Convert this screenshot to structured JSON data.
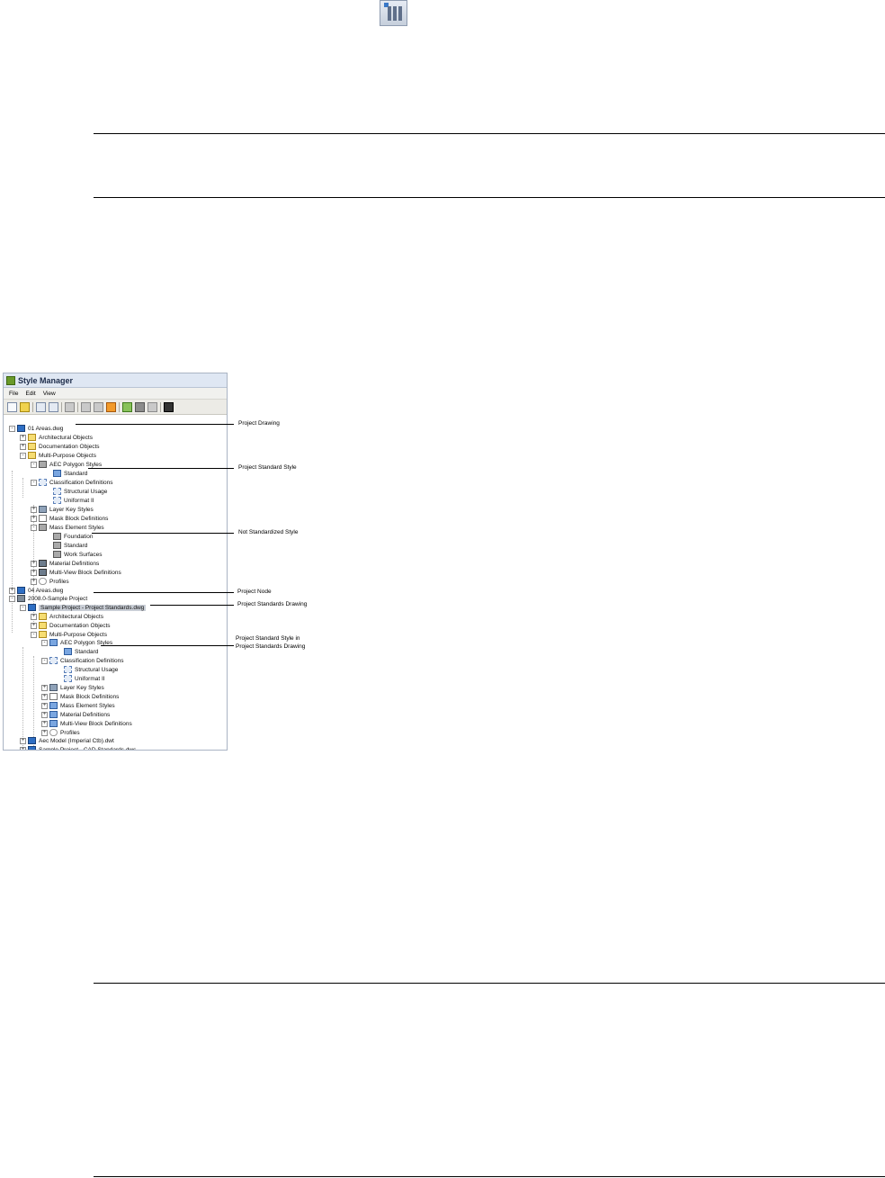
{
  "window": {
    "title": "Style Manager"
  },
  "menu": [
    {
      "label": "File"
    },
    {
      "label": "Edit"
    },
    {
      "label": "View"
    }
  ],
  "toolbar_icons": [
    "new-drawing-icon",
    "open-drawing-icon",
    "copy-icon",
    "paste-icon",
    "edit-style-icon",
    "purge-icon",
    "synchronize-icon",
    "warning-icon",
    "filter-icon",
    "toggle-view-icon",
    "dropdown-icon",
    "help-icon"
  ],
  "tree": {
    "n01": {
      "label": "01 Areas.dwg",
      "exp": "-",
      "icon": "drawing"
    },
    "n02": {
      "label": "Architectural Objects",
      "exp": "+",
      "icon": "folder"
    },
    "n03": {
      "label": "Documentation Objects",
      "exp": "+",
      "icon": "folder"
    },
    "n04": {
      "label": "Multi-Purpose Objects",
      "exp": "-",
      "icon": "folder"
    },
    "n05": {
      "label": "AEC Polygon Styles",
      "exp": "-",
      "icon": "style"
    },
    "n06": {
      "label": "Standard",
      "exp": "",
      "icon": "style-blue"
    },
    "n07": {
      "label": "Classification Definitions",
      "exp": "-",
      "icon": "classif"
    },
    "n08": {
      "label": "Structural Usage",
      "exp": "",
      "icon": "classif"
    },
    "n09": {
      "label": "Uniformat II",
      "exp": "",
      "icon": "classif"
    },
    "n10": {
      "label": "Layer Key Styles",
      "exp": "+",
      "icon": "layer"
    },
    "n11": {
      "label": "Mask Block Definitions",
      "exp": "+",
      "icon": "mask"
    },
    "n12": {
      "label": "Mass Element Styles",
      "exp": "-",
      "icon": "style"
    },
    "n13": {
      "label": "Foundation",
      "exp": "",
      "icon": "style"
    },
    "n14": {
      "label": "Standard",
      "exp": "",
      "icon": "style"
    },
    "n15": {
      "label": "Work Surfaces",
      "exp": "",
      "icon": "style"
    },
    "n16": {
      "label": "Material Definitions",
      "exp": "+",
      "icon": "material"
    },
    "n17": {
      "label": "Multi-View Block Definitions",
      "exp": "+",
      "icon": "material"
    },
    "n18": {
      "label": "Profiles",
      "exp": "+",
      "icon": "profile"
    },
    "n19": {
      "label": "04 Areas.dwg",
      "exp": "+",
      "icon": "drawing"
    },
    "n20": {
      "label": "2008.0-Sample Project",
      "exp": "-",
      "icon": "project"
    },
    "n21": {
      "label": "Sample Project - Project Standards.dwg",
      "exp": "-",
      "icon": "drawing"
    },
    "n22": {
      "label": "Architectural Objects",
      "exp": "+",
      "icon": "folder"
    },
    "n23": {
      "label": "Documentation Objects",
      "exp": "+",
      "icon": "folder"
    },
    "n24": {
      "label": "Multi-Purpose Objects",
      "exp": "-",
      "icon": "folder"
    },
    "n25": {
      "label": "AEC Polygon Styles",
      "exp": "-",
      "icon": "style-blue"
    },
    "n26": {
      "label": "Standard",
      "exp": "",
      "icon": "style-blue"
    },
    "n27": {
      "label": "Classification Definitions",
      "exp": "-",
      "icon": "classif"
    },
    "n28": {
      "label": "Structural Usage",
      "exp": "",
      "icon": "classif"
    },
    "n29": {
      "label": "Uniformat II",
      "exp": "",
      "icon": "classif"
    },
    "n30": {
      "label": "Layer Key Styles",
      "exp": "+",
      "icon": "layer"
    },
    "n31": {
      "label": "Mask Block Definitions",
      "exp": "+",
      "icon": "mask"
    },
    "n32": {
      "label": "Mass Element Styles",
      "exp": "+",
      "icon": "style-blue"
    },
    "n33": {
      "label": "Material Definitions",
      "exp": "+",
      "icon": "style-blue"
    },
    "n34": {
      "label": "Multi-View Block Definitions",
      "exp": "+",
      "icon": "style-blue"
    },
    "n35": {
      "label": "Profiles",
      "exp": "+",
      "icon": "profile"
    },
    "n36": {
      "label": "Aec Model (Imperial Ctb).dwt",
      "exp": "+",
      "icon": "drawing"
    },
    "n37": {
      "label": "Sample Project - CAD Standards.dws",
      "exp": "+",
      "icon": "drawing"
    }
  },
  "callouts": {
    "project_drawing": "Project Drawing",
    "project_standard_style": "Project Standard Style",
    "not_standardized_style": "Not Standardized Style",
    "project_node": "Project Node",
    "project_standards_drawing": "Project Standards Drawing",
    "project_standard_style_in_line1": "Project Standard Style in",
    "project_standard_style_in_line2": "Project Standards Drawing"
  }
}
